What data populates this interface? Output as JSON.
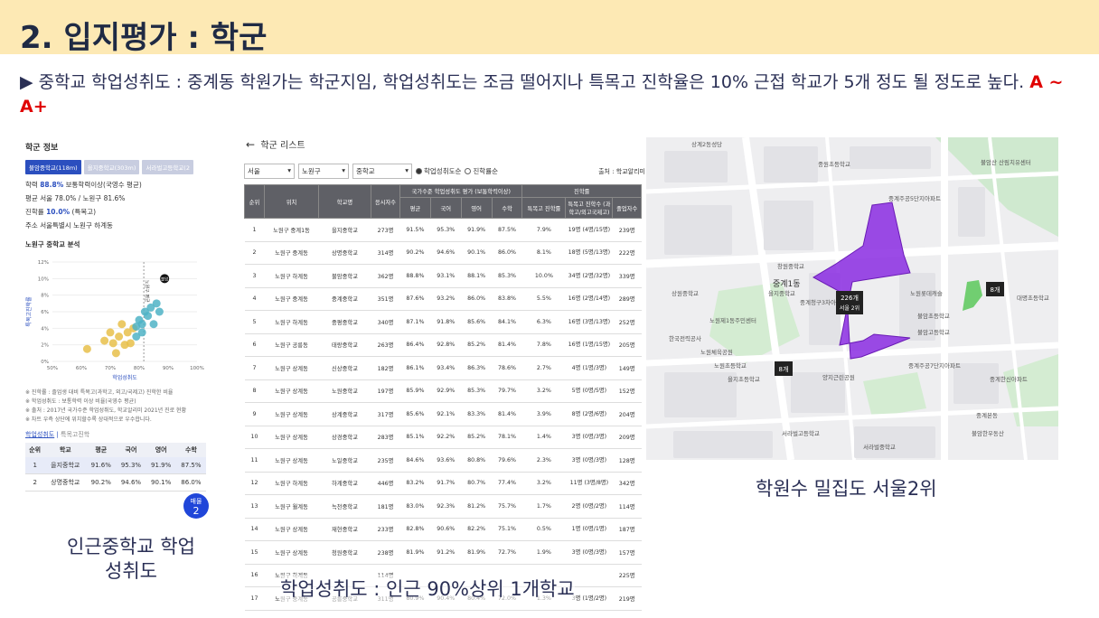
{
  "slide": {
    "title": "2. 입지평가 : 학군",
    "subtitle": "▶ 중학교 학업성취도 : 중계동 학원가는 학군지임, 학업성취도는 조금 떨어지나 특목고 진학율은 10% 근접 학교가 5개 정도 될 정도로 높다.",
    "grade": "A ~ A+"
  },
  "left_panel": {
    "header": "학군 정보",
    "tabs": [
      "불암중학교(118m)",
      "을지중학교(303m)",
      "서라벌고등학교(2"
    ],
    "stats": [
      {
        "label": "학력",
        "value": "88.8%",
        "rest": "보통학력이상(국영수 평균)"
      },
      {
        "label": "평균",
        "value": "",
        "rest": "서울 78.0% / 노원구 81.6%"
      },
      {
        "label": "진학률",
        "value": "10.0%",
        "rest": "(특목고)"
      },
      {
        "label": "주소",
        "value": "",
        "rest": "서울특별시 노원구 하계동"
      }
    ],
    "chart_header": "노원구 중학교 분석",
    "chart_data": {
      "type": "scatter",
      "xlabel": "학업성취도",
      "ylabel": "특목고진학률",
      "x_ticks": [
        "50%",
        "60%",
        "70%",
        "80%",
        "90%",
        "100%"
      ],
      "y_ticks": [
        "0%",
        "2%",
        "4%",
        "6%",
        "8%",
        "10%",
        "12%"
      ],
      "xlim": [
        50,
        100
      ],
      "ylim": [
        0,
        12
      ],
      "yellow_points": [
        [
          62,
          1.5
        ],
        [
          68,
          2.5
        ],
        [
          70,
          3.5
        ],
        [
          71,
          2.2
        ],
        [
          72,
          1.0
        ],
        [
          73,
          3.0
        ],
        [
          74,
          4.5
        ],
        [
          75,
          2.0
        ],
        [
          76,
          3.5
        ],
        [
          77,
          2.2
        ],
        [
          78,
          4.0
        ]
      ],
      "teal_points": [
        [
          79,
          3.0
        ],
        [
          80,
          5.0
        ],
        [
          81,
          4.5
        ],
        [
          82,
          6.0
        ],
        [
          83,
          5.5
        ],
        [
          84,
          6.5
        ],
        [
          85,
          4.5
        ],
        [
          86,
          7.0
        ],
        [
          87,
          6.0
        ],
        [
          79,
          4.2
        ],
        [
          81,
          3.5
        ]
      ],
      "highlight": {
        "x": 88.8,
        "y": 10.0,
        "label": "불암"
      },
      "ref_label": "노원구 평균"
    },
    "notes": [
      "※ 진학률 : 졸업생 대비 특목고(과학고, 외고/국제고) 진학한 비율",
      "※ 학업성취도 : 보통학력 이상 비율(국영수 평균)",
      "※ 출처 : 2017년 국가수준 학업성취도, 학교알리미 2021년 진로 현황",
      "※ 차트 우측 상단에 위치할수록 상대적으로 우수합니다."
    ],
    "mini_tabs": [
      "학업성취도",
      "특목고진학"
    ],
    "mini_table": {
      "headers": [
        "순위",
        "학교",
        "평균",
        "국어",
        "영어",
        "수학"
      ],
      "rows": [
        [
          "1",
          "을지중학교",
          "91.6%",
          "95.3%",
          "91.9%",
          "87.5%"
        ],
        [
          "2",
          "상명중학교",
          "90.2%",
          "94.6%",
          "90.1%",
          "86.0%"
        ]
      ]
    },
    "badge": {
      "line1": "매물",
      "line2": "2"
    },
    "caption": "인근중학교 학업성취도"
  },
  "school_list": {
    "header": "학군 리스트",
    "filters": [
      "서울",
      "노원구",
      "중학교"
    ],
    "radios": [
      "학업성취도순",
      "진학률순"
    ],
    "source": "출처 : 학교알리미",
    "headers_top": [
      "순위",
      "위치",
      "학교명",
      "응시자수",
      "국가수준 학업성취도 평가 (보통학력이상)",
      "진학률"
    ],
    "headers_sub": [
      "평균",
      "국어",
      "영어",
      "수학",
      "특목고 진학률",
      "특목고 진학수 (과학고/외고국제고)",
      "졸업자수"
    ],
    "rows": [
      [
        "1",
        "노원구 중계1동",
        "을지중학교",
        "273명",
        "91.5%",
        "95.3%",
        "91.9%",
        "87.5%",
        "7.9%",
        "19명 (4명/15명)",
        "239명"
      ],
      [
        "2",
        "노원구 중계동",
        "상명중학교",
        "314명",
        "90.2%",
        "94.6%",
        "90.1%",
        "86.0%",
        "8.1%",
        "18명 (5명/13명)",
        "222명"
      ],
      [
        "3",
        "노원구 하계동",
        "불암중학교",
        "362명",
        "88.8%",
        "93.1%",
        "88.1%",
        "85.3%",
        "10.0%",
        "34명 (2명/32명)",
        "339명"
      ],
      [
        "4",
        "노원구 중계동",
        "중계중학교",
        "351명",
        "87.6%",
        "93.2%",
        "86.0%",
        "83.8%",
        "5.5%",
        "16명 (2명/14명)",
        "289명"
      ],
      [
        "5",
        "노원구 하계동",
        "중평중학교",
        "340명",
        "87.1%",
        "91.8%",
        "85.6%",
        "84.1%",
        "6.3%",
        "16명 (3명/13명)",
        "252명"
      ],
      [
        "6",
        "노원구 공릉동",
        "태랑중학교",
        "263명",
        "86.4%",
        "92.8%",
        "85.2%",
        "81.4%",
        "7.8%",
        "16명 (1명/15명)",
        "205명"
      ],
      [
        "7",
        "노원구 상계동",
        "신상중학교",
        "182명",
        "86.1%",
        "93.4%",
        "86.3%",
        "78.6%",
        "2.7%",
        "4명 (1명/3명)",
        "149명"
      ],
      [
        "8",
        "노원구 상계동",
        "노원중학교",
        "197명",
        "85.9%",
        "92.9%",
        "85.3%",
        "79.7%",
        "3.2%",
        "5명 (0명/5명)",
        "152명"
      ],
      [
        "9",
        "노원구 상계동",
        "상계중학교",
        "317명",
        "85.6%",
        "92.1%",
        "83.3%",
        "81.4%",
        "3.9%",
        "8명 (2명/6명)",
        "204명"
      ],
      [
        "10",
        "노원구 상계동",
        "상경중학교",
        "283명",
        "85.1%",
        "92.2%",
        "85.2%",
        "78.1%",
        "1.4%",
        "3명 (0명/3명)",
        "209명"
      ],
      [
        "11",
        "노원구 상계동",
        "노일중학교",
        "235명",
        "84.6%",
        "93.6%",
        "80.8%",
        "79.6%",
        "2.3%",
        "3명 (0명/3명)",
        "128명"
      ],
      [
        "12",
        "노원구 하계동",
        "하계중학교",
        "446명",
        "83.2%",
        "91.7%",
        "80.7%",
        "77.4%",
        "3.2%",
        "11명 (3명/8명)",
        "342명"
      ],
      [
        "13",
        "노원구 월계동",
        "녹천중학교",
        "181명",
        "83.0%",
        "92.3%",
        "81.2%",
        "75.7%",
        "1.7%",
        "2명 (0명/2명)",
        "114명"
      ],
      [
        "14",
        "노원구 상계동",
        "재현중학교",
        "233명",
        "82.8%",
        "90.6%",
        "82.2%",
        "75.1%",
        "0.5%",
        "1명 (0명/1명)",
        "187명"
      ],
      [
        "15",
        "노원구 상계동",
        "청원중학교",
        "238명",
        "81.9%",
        "91.2%",
        "81.9%",
        "72.7%",
        "1.9%",
        "3명 (0명/3명)",
        "157명"
      ],
      [
        "16",
        "노원구 하계동",
        "",
        "114명",
        "",
        "",
        "",
        "",
        "",
        "",
        "225명"
      ],
      [
        "17",
        "노원구 중계동",
        "공릉중학교",
        "311명",
        "80.9%",
        "90.4%",
        "80.4%",
        "72.0%",
        "1.3%",
        "3명 (1명/2명)",
        "219명"
      ]
    ],
    "caption": "학업성취도 : 인근 90%상위 1개학교"
  },
  "map": {
    "caption": "학원수 밀집도 서울2위",
    "markers": [
      {
        "label": "226개",
        "sub": "서울 2위"
      },
      {
        "label": "8개"
      },
      {
        "label": "8개"
      }
    ],
    "places": [
      "불암산 산림치유센터",
      "상계2동성당",
      "중계주공5단지아파트",
      "중계청구3차아파트",
      "중계1동",
      "을지중학교",
      "을지초등학교",
      "불암고등학교",
      "노원제1동주민센터",
      "한국전력공사",
      "양지근린공원",
      "서라벌고등학교",
      "서라벌중학교",
      "중계한신아파트",
      "노원롯데캐슬",
      "불암초등학교",
      "창원중학교",
      "중원초등학교",
      "상원중학교",
      "노원체육공원",
      "중계주공7단지아파트",
      "노원초등학교",
      "대명초등학교",
      "중계본동",
      "불암한우동산"
    ]
  }
}
